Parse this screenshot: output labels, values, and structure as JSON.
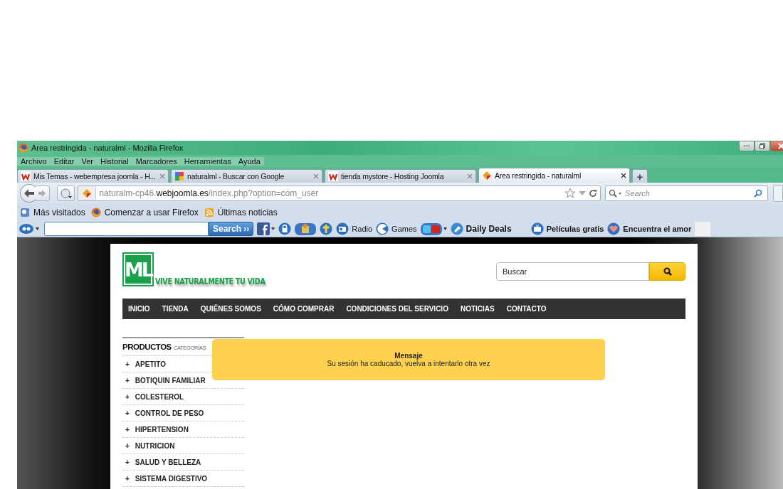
{
  "window": {
    "title": "Area restringida - naturalml - Mozilla Firefox"
  },
  "menu": [
    "Archivo",
    "Editar",
    "Ver",
    "Historial",
    "Marcadores",
    "Herramientas",
    "Ayuda"
  ],
  "tabs": [
    {
      "title": "Mis Temas - webempresa joomla - H...",
      "selected": false
    },
    {
      "title": "naturalml - Buscar con Google",
      "selected": false
    },
    {
      "title": "tienda mystore - Hosting Joomla",
      "selected": false
    },
    {
      "title": "Area restringida - naturalml",
      "selected": true
    }
  ],
  "new_tab": "+",
  "address": {
    "prefix": "naturalm-cp46.",
    "domain": "webjoomla.es",
    "path": "/index.php?option=com_user"
  },
  "browser_search": {
    "placeholder": "Search"
  },
  "bookmarks": [
    {
      "label": "Más visitados"
    },
    {
      "label": "Comenzar a usar Firefox"
    },
    {
      "label": "Últimas noticias"
    }
  ],
  "toolbar": {
    "search_button": "Search ››",
    "items": [
      {
        "kind": "icon"
      },
      {
        "kind": "icon"
      },
      {
        "kind": "icon"
      },
      {
        "kind": "icon"
      },
      {
        "kind": "labeled",
        "label": "Radio"
      },
      {
        "kind": "labeled",
        "label": "Games"
      },
      {
        "kind": "icon"
      },
      {
        "kind": "deal",
        "label": "Daily Deals"
      },
      {
        "kind": "labeled",
        "label": "Películas gratis"
      },
      {
        "kind": "labeled",
        "label": "Encuentra el amor"
      }
    ]
  },
  "site": {
    "logo_mark": "ML",
    "tagline": "VIVE NATURALMENTE TU VIDA",
    "search": {
      "placeholder": "Buscar"
    },
    "nav": [
      "INICIO",
      "TIENDA",
      "QUIÉNES SOMOS",
      "CÓMO COMPRAR",
      "CONDICIONES DEL SERVICIO",
      "NOTICIAS",
      "CONTACTO"
    ],
    "sidebar": {
      "title": "PRODUCTOS",
      "subtitle": "CATEGORÍAS",
      "items": [
        {
          "marker": "+",
          "label": "APETITO"
        },
        {
          "marker": "+",
          "label": "BOTIQUIN FAMILIAR"
        },
        {
          "marker": "+",
          "label": "COLESTEROL"
        },
        {
          "marker": "+",
          "label": "CONTROL DE PESO"
        },
        {
          "marker": "+",
          "label": "HIPERTENSION"
        },
        {
          "marker": "+",
          "label": "NUTRICION"
        },
        {
          "marker": "+",
          "label": "SALUD Y BELLEZA"
        },
        {
          "marker": "+",
          "label": "SISTEMA DIGESTIVO"
        }
      ]
    },
    "message": {
      "title": "Mensaje",
      "text": "Su sesión ha caducado, vuelva a intentarlo otra vez"
    }
  }
}
